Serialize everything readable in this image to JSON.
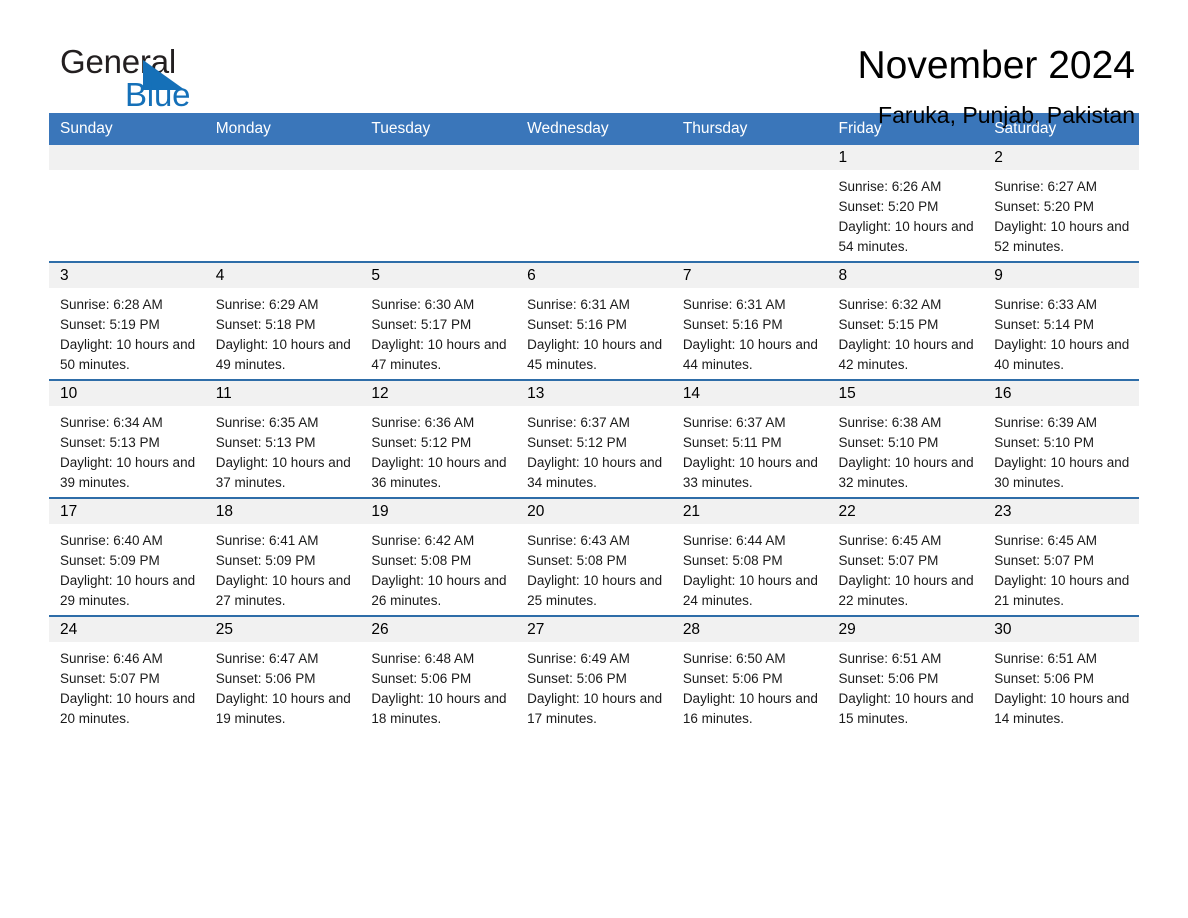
{
  "brand": {
    "name_part1": "General",
    "name_part2": "Blue",
    "accent_color": "#1570b8"
  },
  "header": {
    "title": "November 2024",
    "location": "Faruka, Punjab, Pakistan"
  },
  "calendar": {
    "header_bg": "#3a76ba",
    "row_divider": "#2e6da8",
    "daynum_bg": "#f1f1f1",
    "weekdays": [
      "Sunday",
      "Monday",
      "Tuesday",
      "Wednesday",
      "Thursday",
      "Friday",
      "Saturday"
    ],
    "weeks": [
      [
        {
          "day": "",
          "blank": true
        },
        {
          "day": "",
          "blank": true
        },
        {
          "day": "",
          "blank": true
        },
        {
          "day": "",
          "blank": true
        },
        {
          "day": "",
          "blank": true
        },
        {
          "day": "1",
          "sunrise": "Sunrise: 6:26 AM",
          "sunset": "Sunset: 5:20 PM",
          "daylight": "Daylight: 10 hours and 54 minutes."
        },
        {
          "day": "2",
          "sunrise": "Sunrise: 6:27 AM",
          "sunset": "Sunset: 5:20 PM",
          "daylight": "Daylight: 10 hours and 52 minutes."
        }
      ],
      [
        {
          "day": "3",
          "sunrise": "Sunrise: 6:28 AM",
          "sunset": "Sunset: 5:19 PM",
          "daylight": "Daylight: 10 hours and 50 minutes."
        },
        {
          "day": "4",
          "sunrise": "Sunrise: 6:29 AM",
          "sunset": "Sunset: 5:18 PM",
          "daylight": "Daylight: 10 hours and 49 minutes."
        },
        {
          "day": "5",
          "sunrise": "Sunrise: 6:30 AM",
          "sunset": "Sunset: 5:17 PM",
          "daylight": "Daylight: 10 hours and 47 minutes."
        },
        {
          "day": "6",
          "sunrise": "Sunrise: 6:31 AM",
          "sunset": "Sunset: 5:16 PM",
          "daylight": "Daylight: 10 hours and 45 minutes."
        },
        {
          "day": "7",
          "sunrise": "Sunrise: 6:31 AM",
          "sunset": "Sunset: 5:16 PM",
          "daylight": "Daylight: 10 hours and 44 minutes."
        },
        {
          "day": "8",
          "sunrise": "Sunrise: 6:32 AM",
          "sunset": "Sunset: 5:15 PM",
          "daylight": "Daylight: 10 hours and 42 minutes."
        },
        {
          "day": "9",
          "sunrise": "Sunrise: 6:33 AM",
          "sunset": "Sunset: 5:14 PM",
          "daylight": "Daylight: 10 hours and 40 minutes."
        }
      ],
      [
        {
          "day": "10",
          "sunrise": "Sunrise: 6:34 AM",
          "sunset": "Sunset: 5:13 PM",
          "daylight": "Daylight: 10 hours and 39 minutes."
        },
        {
          "day": "11",
          "sunrise": "Sunrise: 6:35 AM",
          "sunset": "Sunset: 5:13 PM",
          "daylight": "Daylight: 10 hours and 37 minutes."
        },
        {
          "day": "12",
          "sunrise": "Sunrise: 6:36 AM",
          "sunset": "Sunset: 5:12 PM",
          "daylight": "Daylight: 10 hours and 36 minutes."
        },
        {
          "day": "13",
          "sunrise": "Sunrise: 6:37 AM",
          "sunset": "Sunset: 5:12 PM",
          "daylight": "Daylight: 10 hours and 34 minutes."
        },
        {
          "day": "14",
          "sunrise": "Sunrise: 6:37 AM",
          "sunset": "Sunset: 5:11 PM",
          "daylight": "Daylight: 10 hours and 33 minutes."
        },
        {
          "day": "15",
          "sunrise": "Sunrise: 6:38 AM",
          "sunset": "Sunset: 5:10 PM",
          "daylight": "Daylight: 10 hours and 32 minutes."
        },
        {
          "day": "16",
          "sunrise": "Sunrise: 6:39 AM",
          "sunset": "Sunset: 5:10 PM",
          "daylight": "Daylight: 10 hours and 30 minutes."
        }
      ],
      [
        {
          "day": "17",
          "sunrise": "Sunrise: 6:40 AM",
          "sunset": "Sunset: 5:09 PM",
          "daylight": "Daylight: 10 hours and 29 minutes."
        },
        {
          "day": "18",
          "sunrise": "Sunrise: 6:41 AM",
          "sunset": "Sunset: 5:09 PM",
          "daylight": "Daylight: 10 hours and 27 minutes."
        },
        {
          "day": "19",
          "sunrise": "Sunrise: 6:42 AM",
          "sunset": "Sunset: 5:08 PM",
          "daylight": "Daylight: 10 hours and 26 minutes."
        },
        {
          "day": "20",
          "sunrise": "Sunrise: 6:43 AM",
          "sunset": "Sunset: 5:08 PM",
          "daylight": "Daylight: 10 hours and 25 minutes."
        },
        {
          "day": "21",
          "sunrise": "Sunrise: 6:44 AM",
          "sunset": "Sunset: 5:08 PM",
          "daylight": "Daylight: 10 hours and 24 minutes."
        },
        {
          "day": "22",
          "sunrise": "Sunrise: 6:45 AM",
          "sunset": "Sunset: 5:07 PM",
          "daylight": "Daylight: 10 hours and 22 minutes."
        },
        {
          "day": "23",
          "sunrise": "Sunrise: 6:45 AM",
          "sunset": "Sunset: 5:07 PM",
          "daylight": "Daylight: 10 hours and 21 minutes."
        }
      ],
      [
        {
          "day": "24",
          "sunrise": "Sunrise: 6:46 AM",
          "sunset": "Sunset: 5:07 PM",
          "daylight": "Daylight: 10 hours and 20 minutes."
        },
        {
          "day": "25",
          "sunrise": "Sunrise: 6:47 AM",
          "sunset": "Sunset: 5:06 PM",
          "daylight": "Daylight: 10 hours and 19 minutes."
        },
        {
          "day": "26",
          "sunrise": "Sunrise: 6:48 AM",
          "sunset": "Sunset: 5:06 PM",
          "daylight": "Daylight: 10 hours and 18 minutes."
        },
        {
          "day": "27",
          "sunrise": "Sunrise: 6:49 AM",
          "sunset": "Sunset: 5:06 PM",
          "daylight": "Daylight: 10 hours and 17 minutes."
        },
        {
          "day": "28",
          "sunrise": "Sunrise: 6:50 AM",
          "sunset": "Sunset: 5:06 PM",
          "daylight": "Daylight: 10 hours and 16 minutes."
        },
        {
          "day": "29",
          "sunrise": "Sunrise: 6:51 AM",
          "sunset": "Sunset: 5:06 PM",
          "daylight": "Daylight: 10 hours and 15 minutes."
        },
        {
          "day": "30",
          "sunrise": "Sunrise: 6:51 AM",
          "sunset": "Sunset: 5:06 PM",
          "daylight": "Daylight: 10 hours and 14 minutes."
        }
      ]
    ]
  }
}
